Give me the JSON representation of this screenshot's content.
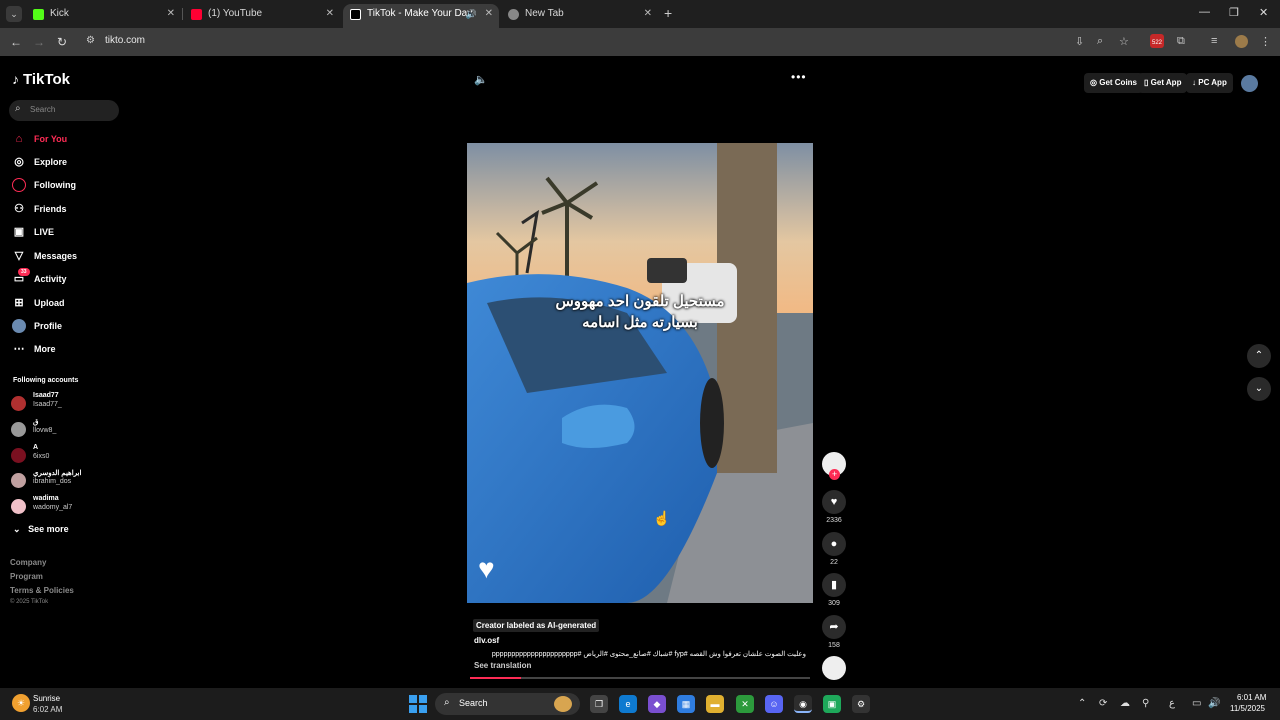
{
  "browser": {
    "tabs": [
      {
        "label": "Kick",
        "color": "#53fc18"
      },
      {
        "label": "(1) YouTube",
        "color": "#ff0033"
      },
      {
        "label": "TikTok - Make Your Day",
        "color": "#ffffff"
      },
      {
        "label": "New Tab",
        "color": "#cccccc"
      }
    ],
    "url": "tikto.com",
    "extension_badge": "522"
  },
  "sidebar": {
    "logo": "TikTok",
    "search_placeholder": "Search",
    "nav": [
      {
        "label": "For You",
        "icon": "home-icon",
        "glyph": "⌂"
      },
      {
        "label": "Explore",
        "icon": "compass-icon",
        "glyph": "◎"
      },
      {
        "label": "Following",
        "icon": "following-icon",
        "glyph": "●"
      },
      {
        "label": "Friends",
        "icon": "friends-icon",
        "glyph": "👥"
      },
      {
        "label": "LIVE",
        "icon": "live-icon",
        "glyph": "▣"
      },
      {
        "label": "Messages",
        "icon": "messages-icon",
        "glyph": "▽"
      },
      {
        "label": "Activity",
        "icon": "activity-icon",
        "glyph": "▭",
        "badge": "33"
      },
      {
        "label": "Upload",
        "icon": "upload-icon",
        "glyph": "⊞"
      },
      {
        "label": "Profile",
        "icon": "profile-icon",
        "glyph": "●"
      },
      {
        "label": "More",
        "icon": "more-icon",
        "glyph": "⋯"
      }
    ],
    "following_heading": "Following accounts",
    "accounts": [
      {
        "name": "Isaad77",
        "handle": "Isaad77_",
        "color": "#b03030"
      },
      {
        "name": "ق",
        "handle": "llovw8_",
        "color": "#999999"
      },
      {
        "name": "A",
        "handle": "6ixs0",
        "color": "#7a1020"
      },
      {
        "name": "ابراهيم الدوسري",
        "handle": "ibrahim_dos",
        "color": "#c0a0a0"
      },
      {
        "name": "wadima",
        "handle": "wadomy_al7",
        "color": "#f0c0c8"
      }
    ],
    "see_more": "See more",
    "footer": [
      "Company",
      "Program",
      "Terms & Policies"
    ],
    "copyright": "© 2025 TikTok"
  },
  "video": {
    "overlay_line1": "مستحيل تلقون احد مهووس",
    "overlay_line2": "بسيارته مثل اسامه",
    "ai_label": "Creator labeled as AI-generated",
    "author": "dlv.osf",
    "description": "وعليت الصوت علشان تعرفوا وش القصه #fyp #شباك #صانع_محتوى #الرياض #pppppppppppppppppppppp",
    "see_translation": "See translation",
    "progress_fraction": 0.15
  },
  "actions": {
    "likes": "2336",
    "comments": "22",
    "saves": "309",
    "shares": "158"
  },
  "top_right": {
    "get_coins": "Get Coins",
    "get_app": "Get App",
    "pc_app": "PC App"
  },
  "taskbar": {
    "weather_name": "Sunrise",
    "weather_time": "6:02 AM",
    "search": "Search",
    "time": "6:01 AM",
    "date": "11/5/2025"
  }
}
